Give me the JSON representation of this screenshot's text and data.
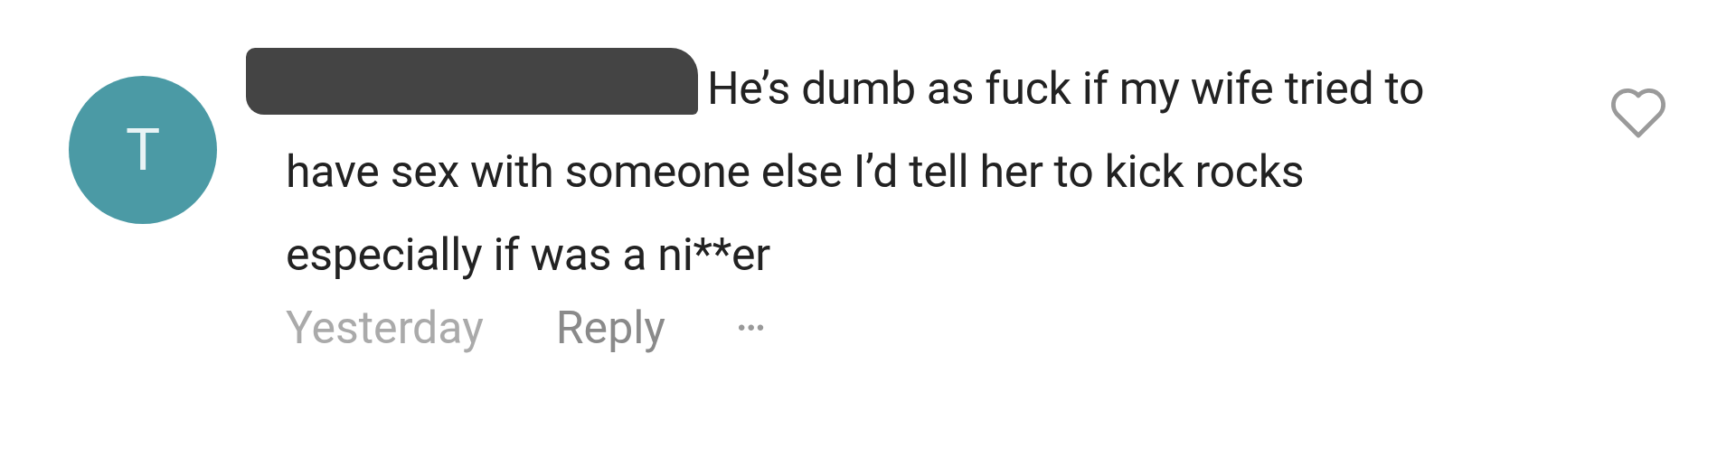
{
  "comment": {
    "avatar_letter": "T",
    "text": "He’s dumb as fuck if my wife tried to have sex with someone else I’d tell her to kick rocks especially if was a ni**er",
    "time": "Yesterday",
    "reply": "Reply",
    "more": "•••",
    "liked": false
  }
}
